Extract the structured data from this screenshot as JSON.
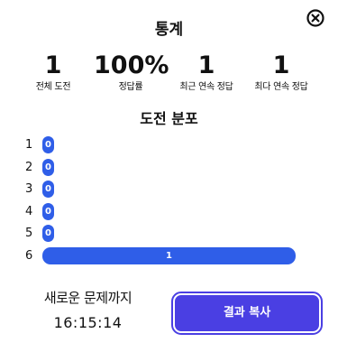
{
  "modal": {
    "title": "통계",
    "close_icon": "close-circle-icon"
  },
  "stats": [
    {
      "value": "1",
      "label": "전체 도전"
    },
    {
      "value": "100%",
      "label": "정답률"
    },
    {
      "value": "1",
      "label": "최근 연속 정답"
    },
    {
      "value": "1",
      "label": "최다 연속 정답"
    }
  ],
  "distribution": {
    "title": "도전 분포",
    "accent_color": "#2f5ee8",
    "rows": [
      {
        "guess": "1",
        "count": 0
      },
      {
        "guess": "2",
        "count": 0
      },
      {
        "guess": "3",
        "count": 0
      },
      {
        "guess": "4",
        "count": 0
      },
      {
        "guess": "5",
        "count": 0
      },
      {
        "guess": "6",
        "count": 1
      }
    ]
  },
  "footer": {
    "next_label": "새로운 문제까지",
    "timer": "16:15:14",
    "share_label": "결과 복사",
    "share_color": "#4a3fe3"
  }
}
